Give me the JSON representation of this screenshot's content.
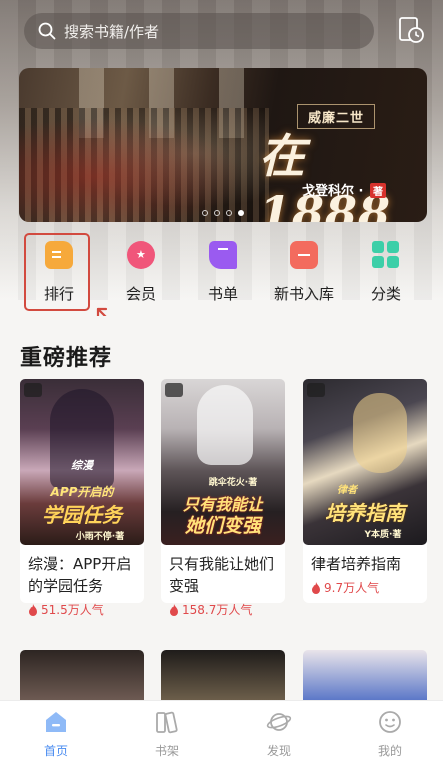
{
  "search": {
    "placeholder": "搜索书籍/作者"
  },
  "banner": {
    "subtitle": "威廉二世",
    "title": "在1888",
    "author": "戈登科尔",
    "author_tag": "著"
  },
  "categories": [
    {
      "label": "排行",
      "icon": "ranking-icon",
      "color": "#f6a93b"
    },
    {
      "label": "会员",
      "icon": "vip-icon",
      "color": "#f0567a"
    },
    {
      "label": "书单",
      "icon": "booklist-icon",
      "color": "#9a5bf0"
    },
    {
      "label": "新书入库",
      "icon": "new-books-icon",
      "color": "#f36b5e"
    },
    {
      "label": "分类",
      "icon": "category-icon",
      "color": "#3ccfa8"
    }
  ],
  "section": {
    "title": "重磅推荐"
  },
  "books": [
    {
      "title": "综漫：APP开启的学园任务",
      "popularity": "51.5万人气",
      "cover_text_1": "综漫",
      "cover_text_2": "APP开启的",
      "cover_text_3": "学园任务",
      "cover_author": "小雨不停·著"
    },
    {
      "title": "只有我能让她们变强",
      "popularity": "158.7万人气",
      "cover_text_1": "",
      "cover_text_2": "只有我能让",
      "cover_text_3": "她们变强",
      "cover_author": "跳伞花火·著"
    },
    {
      "title": "律者培养指南",
      "popularity": "9.7万人气",
      "cover_text_1": "律者",
      "cover_text_2": "",
      "cover_text_3": "培养指南",
      "cover_author": "Y本质·著"
    }
  ],
  "tabs": [
    {
      "label": "首页",
      "icon": "home-icon",
      "active": true
    },
    {
      "label": "书架",
      "icon": "bookshelf-icon",
      "active": false
    },
    {
      "label": "发现",
      "icon": "discover-icon",
      "active": false
    },
    {
      "label": "我的",
      "icon": "profile-icon",
      "active": false
    }
  ],
  "colors": {
    "accent": "#4a8cf0",
    "highlight": "#d24a3f",
    "popularity": "#e0494b"
  }
}
